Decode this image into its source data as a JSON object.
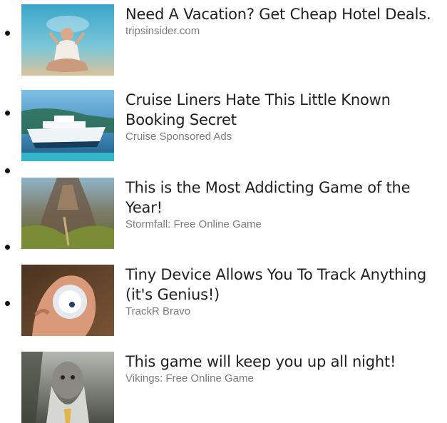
{
  "ads": [
    {
      "title": "Need A Vacation? Get Cheap Hotel Deals.",
      "source": "tripsinsider.com",
      "image": "yoga-pose-beach-photo"
    },
    {
      "title": "Cruise Liners Hate This Little Known Booking Secret",
      "source": "Cruise Sponsored Ads",
      "image": "cruise-ship-photo"
    },
    {
      "title": "This is the Most Addicting Game of the Year!",
      "source": "Stormfall: Free Online Game",
      "image": "fantasy-landscape-game-art"
    },
    {
      "title": "Tiny Device Allows You To Track Anything (it's Genius!)",
      "source": "TrackR Bravo",
      "image": "hand-holding-tracker-photo"
    },
    {
      "title": "This game will keep you up all night!",
      "source": "Vikings: Free Online Game",
      "image": "viking-warrior-game-art"
    }
  ]
}
